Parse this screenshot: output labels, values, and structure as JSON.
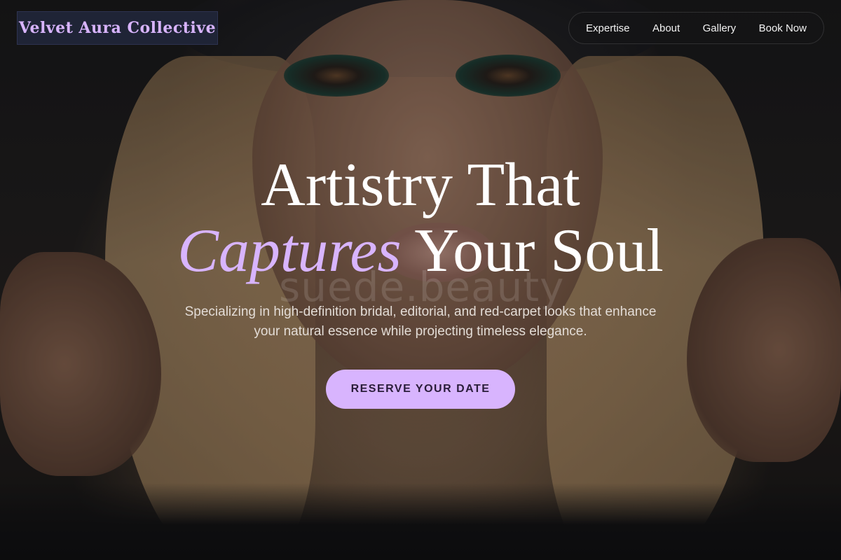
{
  "brand": {
    "name": "Velvet Aura Collective"
  },
  "nav": {
    "items": [
      {
        "label": "Expertise"
      },
      {
        "label": "About"
      },
      {
        "label": "Gallery"
      },
      {
        "label": "Book Now"
      }
    ]
  },
  "hero": {
    "headline_line1": "Artistry That",
    "headline_accent": "Captures",
    "headline_rest": "Your Soul",
    "subtitle": "Specializing in high-definition bridal, editorial, and red-carpet looks that enhance your natural essence while projecting timeless elegance.",
    "cta_label": "RESERVE YOUR DATE",
    "watermark": "suede.beauty"
  },
  "colors": {
    "accent": "#d8b4fe",
    "brand_bg": "#1f2436",
    "text_light": "#ffffff"
  }
}
